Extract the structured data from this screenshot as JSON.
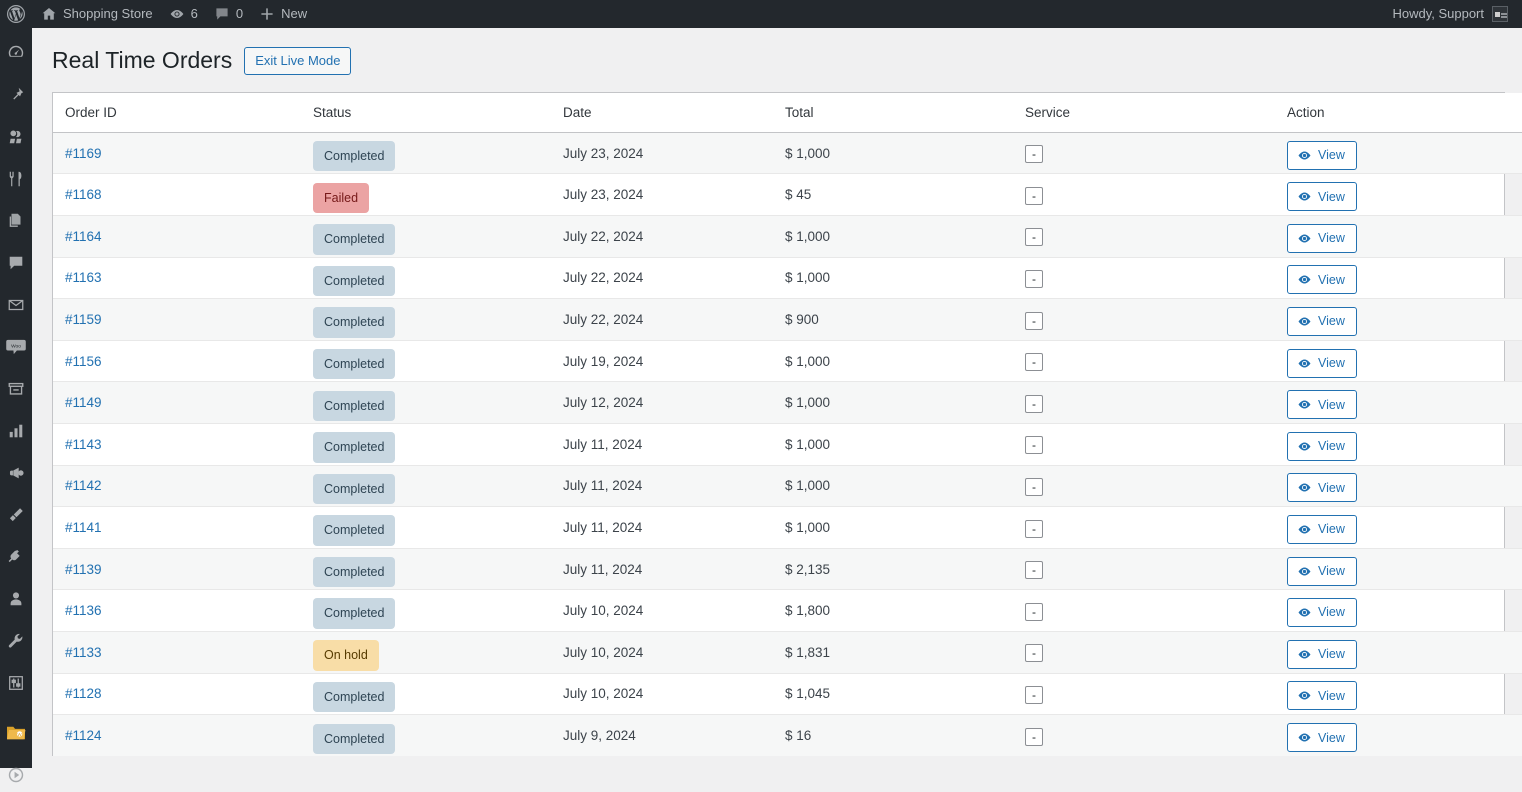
{
  "adminbar": {
    "wp_logo_icon": "wordpress-icon",
    "site": {
      "icon": "home-icon",
      "label": "Shopping Store"
    },
    "updates": {
      "icon": "updates-icon",
      "count": "6"
    },
    "comments": {
      "icon": "comment-bubble-icon",
      "count": "0"
    },
    "new": {
      "icon": "plus-icon",
      "label": "New"
    },
    "account": {
      "label": "Howdy, Support",
      "avatar_icon": "avatar-image"
    }
  },
  "sidebar": {
    "items": [
      {
        "icon": "dashboard-icon"
      },
      {
        "icon": "pin-icon"
      },
      {
        "icon": "media-icon"
      },
      {
        "icon": "restaurant-icon"
      },
      {
        "icon": "pages-icon"
      },
      {
        "icon": "comments-icon"
      },
      {
        "icon": "email-icon"
      },
      {
        "icon": "woocommerce-icon"
      },
      {
        "icon": "products-icon"
      },
      {
        "icon": "analytics-icon"
      },
      {
        "icon": "marketing-icon"
      },
      {
        "icon": "appearance-icon"
      },
      {
        "icon": "plugins-icon"
      },
      {
        "icon": "users-icon"
      },
      {
        "icon": "tools-icon"
      },
      {
        "icon": "settings-icon"
      },
      {
        "icon": "folder-wp-icon"
      },
      {
        "icon": "live-orders-icon"
      }
    ]
  },
  "page": {
    "title": "Real Time Orders",
    "exit_live_mode_label": "Exit Live Mode"
  },
  "table": {
    "columns": [
      "Order ID",
      "Status",
      "Date",
      "Total",
      "Service",
      "Action"
    ],
    "service_value": "-",
    "view_label": "View",
    "view_icon": "eye-icon",
    "rows": [
      {
        "order_id": "#1169",
        "status": "Completed",
        "status_key": "completed",
        "date": "July 23, 2024",
        "total": "$ 1,000"
      },
      {
        "order_id": "#1168",
        "status": "Failed",
        "status_key": "failed",
        "date": "July 23, 2024",
        "total": "$ 45"
      },
      {
        "order_id": "#1164",
        "status": "Completed",
        "status_key": "completed",
        "date": "July 22, 2024",
        "total": "$ 1,000"
      },
      {
        "order_id": "#1163",
        "status": "Completed",
        "status_key": "completed",
        "date": "July 22, 2024",
        "total": "$ 1,000"
      },
      {
        "order_id": "#1159",
        "status": "Completed",
        "status_key": "completed",
        "date": "July 22, 2024",
        "total": "$ 900"
      },
      {
        "order_id": "#1156",
        "status": "Completed",
        "status_key": "completed",
        "date": "July 19, 2024",
        "total": "$ 1,000"
      },
      {
        "order_id": "#1149",
        "status": "Completed",
        "status_key": "completed",
        "date": "July 12, 2024",
        "total": "$ 1,000"
      },
      {
        "order_id": "#1143",
        "status": "Completed",
        "status_key": "completed",
        "date": "July 11, 2024",
        "total": "$ 1,000"
      },
      {
        "order_id": "#1142",
        "status": "Completed",
        "status_key": "completed",
        "date": "July 11, 2024",
        "total": "$ 1,000"
      },
      {
        "order_id": "#1141",
        "status": "Completed",
        "status_key": "completed",
        "date": "July 11, 2024",
        "total": "$ 1,000"
      },
      {
        "order_id": "#1139",
        "status": "Completed",
        "status_key": "completed",
        "date": "July 11, 2024",
        "total": "$ 2,135"
      },
      {
        "order_id": "#1136",
        "status": "Completed",
        "status_key": "completed",
        "date": "July 10, 2024",
        "total": "$ 1,800"
      },
      {
        "order_id": "#1133",
        "status": "On hold",
        "status_key": "onhold",
        "date": "July 10, 2024",
        "total": "$ 1,831"
      },
      {
        "order_id": "#1128",
        "status": "Completed",
        "status_key": "completed",
        "date": "July 10, 2024",
        "total": "$ 1,045"
      },
      {
        "order_id": "#1124",
        "status": "Completed",
        "status_key": "completed",
        "date": "July 9, 2024",
        "total": "$ 16"
      }
    ]
  },
  "colors": {
    "adminbar_bg": "#23282d",
    "link": "#2271b1",
    "completed_badge": "#c8d7e1",
    "failed_badge": "#eba3a3",
    "onhold_badge": "#f8dda7"
  }
}
